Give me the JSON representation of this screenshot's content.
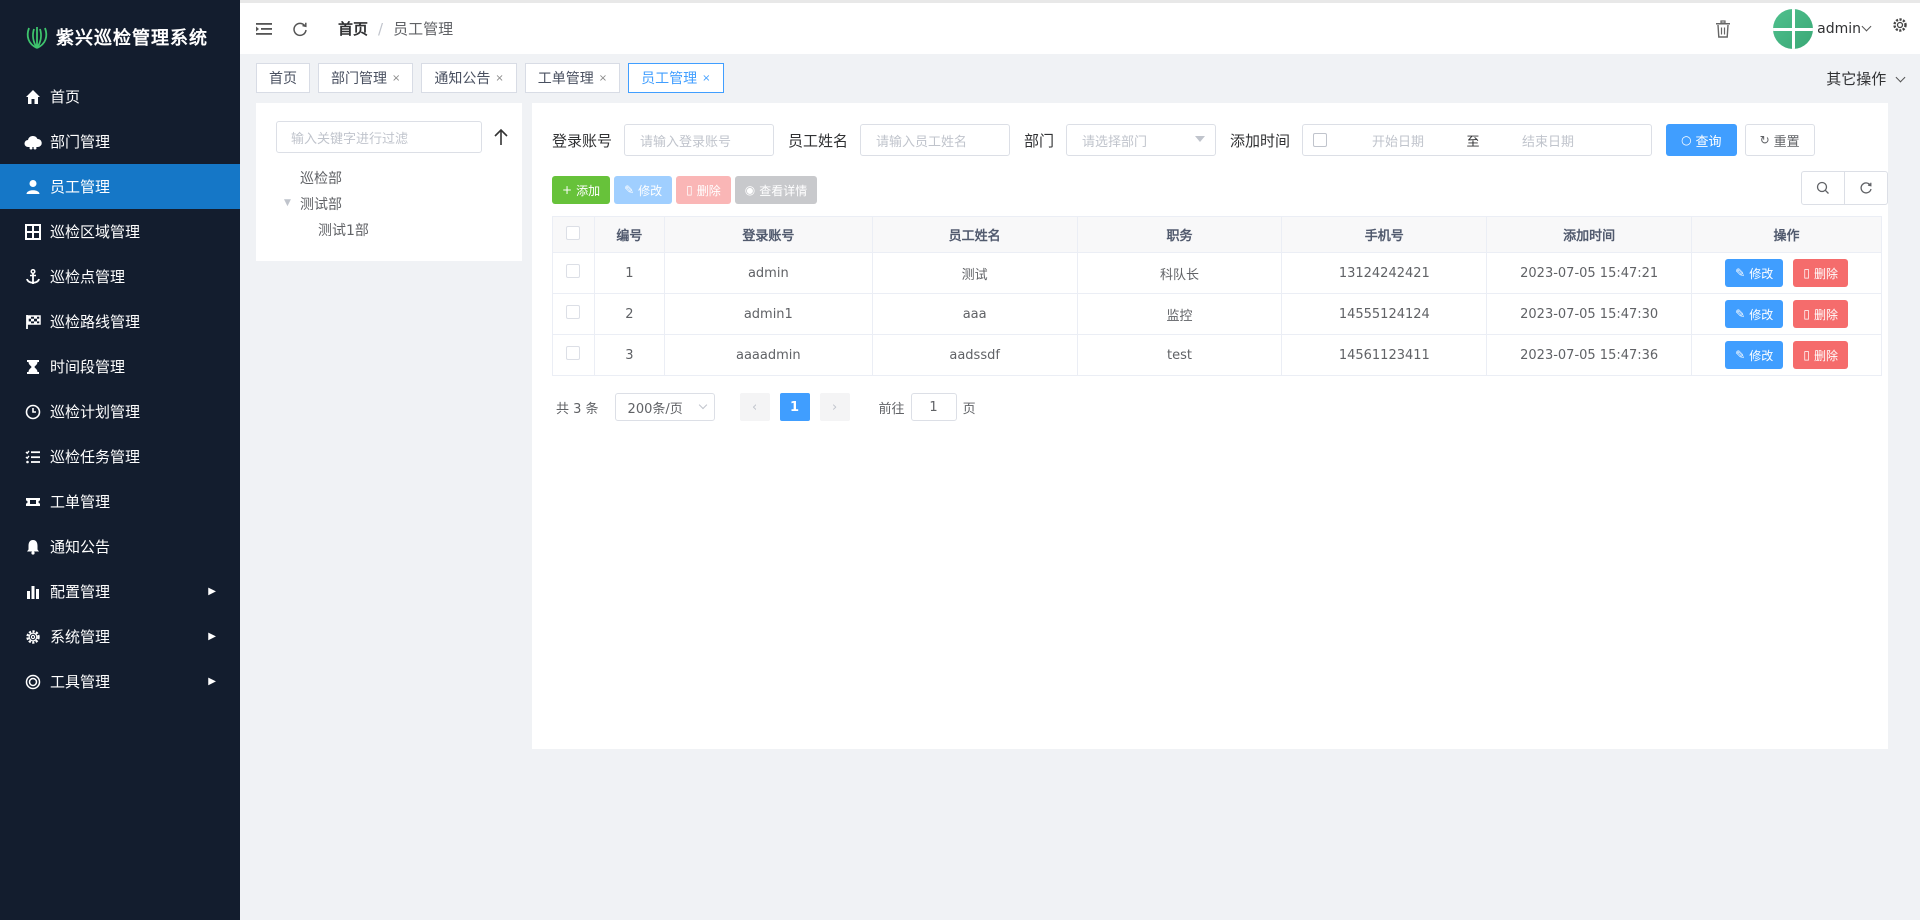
{
  "app": {
    "title": "紫兴巡检管理系统"
  },
  "sidebar": {
    "items": [
      {
        "label": "首页",
        "icon": "home-icon"
      },
      {
        "label": "部门管理",
        "icon": "cloud-icon"
      },
      {
        "label": "员工管理",
        "icon": "user-icon",
        "active": true
      },
      {
        "label": "巡检区域管理",
        "icon": "grid-icon"
      },
      {
        "label": "巡检点管理",
        "icon": "anchor-icon"
      },
      {
        "label": "巡检路线管理",
        "icon": "flag-icon"
      },
      {
        "label": "时间段管理",
        "icon": "hourglass-icon"
      },
      {
        "label": "巡检计划管理",
        "icon": "clock-icon"
      },
      {
        "label": "巡检任务管理",
        "icon": "list-icon"
      },
      {
        "label": "工单管理",
        "icon": "ticket-icon"
      },
      {
        "label": "通知公告",
        "icon": "bell-icon"
      },
      {
        "label": "配置管理",
        "icon": "bar-chart-icon",
        "expandable": true
      },
      {
        "label": "系统管理",
        "icon": "gear-icon",
        "expandable": true
      },
      {
        "label": "工具管理",
        "icon": "target-icon",
        "expandable": true
      }
    ]
  },
  "header": {
    "breadcrumb_home": "首页",
    "breadcrumb_sep": "/",
    "breadcrumb_current": "员工管理",
    "username": "admin"
  },
  "tags": [
    {
      "label": "首页",
      "closable": false
    },
    {
      "label": "部门管理",
      "closable": true
    },
    {
      "label": "通知公告",
      "closable": true
    },
    {
      "label": "工单管理",
      "closable": true
    },
    {
      "label": "员工管理",
      "closable": true,
      "active": true
    }
  ],
  "tag_close": "×",
  "other_ops": "其它操作",
  "tree": {
    "placeholder": "输入关键字进行过滤",
    "nodes": [
      "巡检部",
      "测试部",
      "测试1部"
    ]
  },
  "search": {
    "account_label": "登录账号",
    "account_placeholder": "请输入登录账号",
    "name_label": "员工姓名",
    "name_placeholder": "请输入员工姓名",
    "dept_label": "部门",
    "dept_placeholder": "请选择部门",
    "time_label": "添加时间",
    "start_placeholder": "开始日期",
    "range_sep": "至",
    "end_placeholder": "结束日期",
    "query_label": "查询",
    "reset_label": "重置"
  },
  "toolbar": {
    "add_label": "添加",
    "edit_label": "修改",
    "delete_label": "删除",
    "view_label": "查看详情"
  },
  "table": {
    "columns": [
      "编号",
      "登录账号",
      "员工姓名",
      "职务",
      "手机号",
      "添加时间",
      "操作"
    ],
    "rows": [
      {
        "id": "1",
        "account": "admin",
        "name": "测试",
        "position": "科队长",
        "phone": "13124242421",
        "added": "2023-07-05 15:47:21"
      },
      {
        "id": "2",
        "account": "admin1",
        "name": "aaa",
        "position": "监控",
        "phone": "14555124124",
        "added": "2023-07-05 15:47:30"
      },
      {
        "id": "3",
        "account": "aaaadmin",
        "name": "aadssdf",
        "position": "test",
        "phone": "14561123411",
        "added": "2023-07-05 15:47:36"
      }
    ],
    "row_edit": "修改",
    "row_delete": "删除"
  },
  "pagination": {
    "total": "共 3 条",
    "page_size": "200条/页",
    "current_page": "1",
    "goto_prefix": "前往",
    "goto_value": "1",
    "goto_suffix": "页"
  },
  "colors": {
    "sidebar_bg": "#131d2e",
    "sidebar_active": "#1577c7",
    "primary": "#409eff",
    "success": "#67c23a",
    "danger": "#f56c6c"
  }
}
